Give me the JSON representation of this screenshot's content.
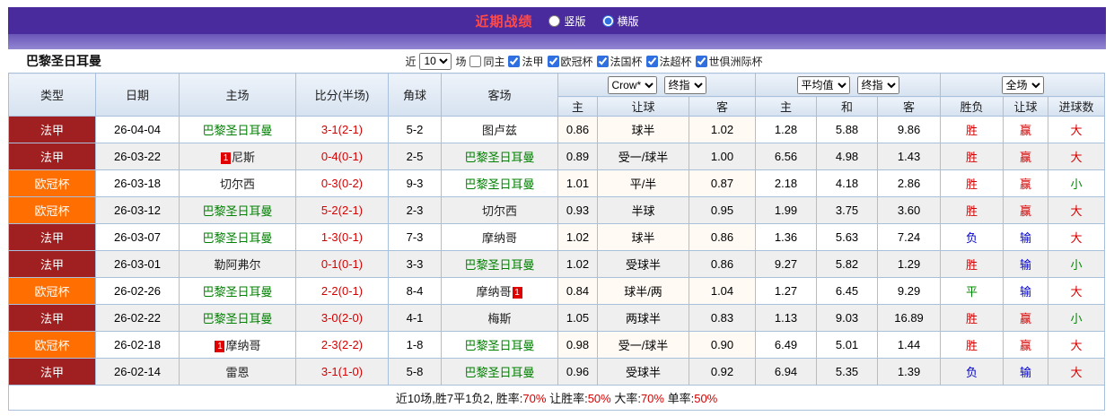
{
  "header": {
    "title": "近期战绩",
    "radio_vertical": "竖版",
    "radio_horizontal": "横版"
  },
  "filter": {
    "team_name": "巴黎圣日耳曼",
    "recent_label": "近",
    "recent_value": "10",
    "games_label": "场",
    "same_home_label": "同主",
    "leagues": [
      "法甲",
      "欧冠杯",
      "法国杯",
      "法超杯",
      "世俱洲际杯"
    ]
  },
  "table": {
    "headers": {
      "type": "类型",
      "date": "日期",
      "home": "主场",
      "score": "比分(半场)",
      "corner": "角球",
      "away": "客场",
      "odds1_select1": "Crow*",
      "odds1_select2": "终指",
      "odds1_cols": [
        "主",
        "让球",
        "客"
      ],
      "odds2_select1": "平均值",
      "odds2_select2": "终指",
      "odds2_cols": [
        "主",
        "和",
        "客"
      ],
      "result_select": "全场",
      "result_cols": [
        "胜负",
        "让球",
        "进球数"
      ]
    },
    "rows": [
      {
        "type": "法甲",
        "type_class": "lg-fa",
        "date": "26-04-04",
        "home": {
          "name": "巴黎圣日耳曼",
          "green": true
        },
        "score": "3-1(2-1)",
        "corner": "5-2",
        "away": {
          "name": "图卢兹"
        },
        "odds": [
          "0.86",
          "球半",
          "1.02"
        ],
        "europe": [
          "1.28",
          "5.88",
          "9.86"
        ],
        "results": [
          {
            "t": "胜",
            "c": "red"
          },
          {
            "t": "赢",
            "c": "red"
          },
          {
            "t": "大",
            "c": "red"
          }
        ]
      },
      {
        "type": "法甲",
        "type_class": "lg-fa",
        "date": "26-03-22",
        "home": {
          "name": "尼斯",
          "card_before": "1"
        },
        "score": "0-4(0-1)",
        "corner": "2-5",
        "away": {
          "name": "巴黎圣日耳曼",
          "green": true
        },
        "odds": [
          "0.89",
          "受一/球半",
          "1.00"
        ],
        "europe": [
          "6.56",
          "4.98",
          "1.43"
        ],
        "results": [
          {
            "t": "胜",
            "c": "red"
          },
          {
            "t": "赢",
            "c": "red"
          },
          {
            "t": "大",
            "c": "red"
          }
        ]
      },
      {
        "type": "欧冠杯",
        "type_class": "lg-ou",
        "date": "26-03-18",
        "home": {
          "name": "切尔西"
        },
        "score": "0-3(0-2)",
        "corner": "9-3",
        "away": {
          "name": "巴黎圣日耳曼",
          "green": true
        },
        "odds": [
          "1.01",
          "平/半",
          "0.87"
        ],
        "europe": [
          "2.18",
          "4.18",
          "2.86"
        ],
        "results": [
          {
            "t": "胜",
            "c": "red"
          },
          {
            "t": "赢",
            "c": "red"
          },
          {
            "t": "小",
            "c": "green"
          }
        ]
      },
      {
        "type": "欧冠杯",
        "type_class": "lg-ou",
        "date": "26-03-12",
        "home": {
          "name": "巴黎圣日耳曼",
          "green": true
        },
        "score": "5-2(2-1)",
        "corner": "2-3",
        "away": {
          "name": "切尔西"
        },
        "odds": [
          "0.93",
          "半球",
          "0.95"
        ],
        "europe": [
          "1.99",
          "3.75",
          "3.60"
        ],
        "results": [
          {
            "t": "胜",
            "c": "red"
          },
          {
            "t": "赢",
            "c": "red"
          },
          {
            "t": "大",
            "c": "red"
          }
        ]
      },
      {
        "type": "法甲",
        "type_class": "lg-fa",
        "date": "26-03-07",
        "home": {
          "name": "巴黎圣日耳曼",
          "green": true
        },
        "score": "1-3(0-1)",
        "corner": "7-3",
        "away": {
          "name": "摩纳哥"
        },
        "odds": [
          "1.02",
          "球半",
          "0.86"
        ],
        "europe": [
          "1.36",
          "5.63",
          "7.24"
        ],
        "results": [
          {
            "t": "负",
            "c": "blue"
          },
          {
            "t": "输",
            "c": "blue"
          },
          {
            "t": "大",
            "c": "red"
          }
        ]
      },
      {
        "type": "法甲",
        "type_class": "lg-fa",
        "date": "26-03-01",
        "home": {
          "name": "勒阿弗尔"
        },
        "score": "0-1(0-1)",
        "corner": "3-3",
        "away": {
          "name": "巴黎圣日耳曼",
          "green": true
        },
        "odds": [
          "1.02",
          "受球半",
          "0.86"
        ],
        "europe": [
          "9.27",
          "5.82",
          "1.29"
        ],
        "results": [
          {
            "t": "胜",
            "c": "red"
          },
          {
            "t": "输",
            "c": "blue"
          },
          {
            "t": "小",
            "c": "green"
          }
        ]
      },
      {
        "type": "欧冠杯",
        "type_class": "lg-ou",
        "date": "26-02-26",
        "home": {
          "name": "巴黎圣日耳曼",
          "green": true
        },
        "score": "2-2(0-1)",
        "corner": "8-4",
        "away": {
          "name": "摩纳哥",
          "card_after": "1"
        },
        "odds": [
          "0.84",
          "球半/两",
          "1.04"
        ],
        "europe": [
          "1.27",
          "6.45",
          "9.29"
        ],
        "results": [
          {
            "t": "平",
            "c": "green"
          },
          {
            "t": "输",
            "c": "blue"
          },
          {
            "t": "大",
            "c": "red"
          }
        ]
      },
      {
        "type": "法甲",
        "type_class": "lg-fa",
        "date": "26-02-22",
        "home": {
          "name": "巴黎圣日耳曼",
          "green": true
        },
        "score": "3-0(2-0)",
        "corner": "4-1",
        "away": {
          "name": "梅斯"
        },
        "odds": [
          "1.05",
          "两球半",
          "0.83"
        ],
        "europe": [
          "1.13",
          "9.03",
          "16.89"
        ],
        "results": [
          {
            "t": "胜",
            "c": "red"
          },
          {
            "t": "赢",
            "c": "red"
          },
          {
            "t": "小",
            "c": "green"
          }
        ]
      },
      {
        "type": "欧冠杯",
        "type_class": "lg-ou",
        "date": "26-02-18",
        "home": {
          "name": "摩纳哥",
          "card_before": "1"
        },
        "score": "2-3(2-2)",
        "corner": "1-8",
        "away": {
          "name": "巴黎圣日耳曼",
          "green": true
        },
        "odds": [
          "0.98",
          "受一/球半",
          "0.90"
        ],
        "europe": [
          "6.49",
          "5.01",
          "1.44"
        ],
        "results": [
          {
            "t": "胜",
            "c": "red"
          },
          {
            "t": "赢",
            "c": "red"
          },
          {
            "t": "大",
            "c": "red"
          }
        ]
      },
      {
        "type": "法甲",
        "type_class": "lg-fa",
        "date": "26-02-14",
        "home": {
          "name": "雷恩"
        },
        "score": "3-1(1-0)",
        "corner": "5-8",
        "away": {
          "name": "巴黎圣日耳曼",
          "green": true
        },
        "odds": [
          "0.96",
          "受球半",
          "0.92"
        ],
        "europe": [
          "6.94",
          "5.35",
          "1.39"
        ],
        "results": [
          {
            "t": "负",
            "c": "blue"
          },
          {
            "t": "输",
            "c": "blue"
          },
          {
            "t": "大",
            "c": "red"
          }
        ]
      }
    ]
  },
  "footer": {
    "part1": "近10场,胜7平1负2, 胜率:",
    "win_rate": "70%",
    "part2": " 让胜率:",
    "handicap_rate": "50%",
    "part3": " 大率:",
    "big_rate": "70%",
    "part4": " 单率:",
    "single_rate": "50%"
  }
}
